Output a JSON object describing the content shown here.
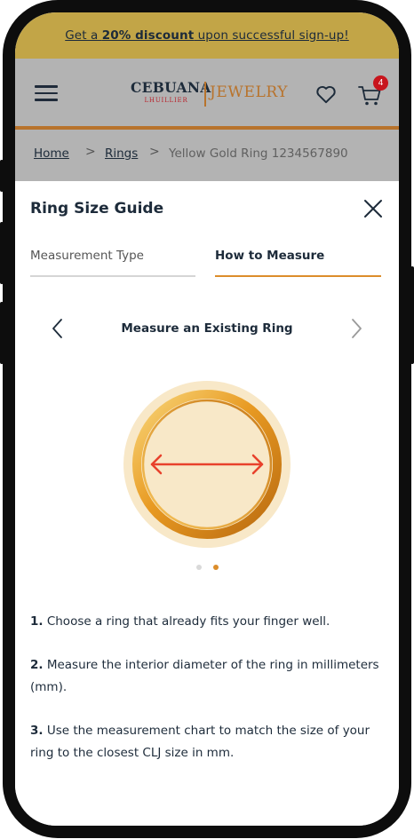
{
  "promo": {
    "prefix": "Get a ",
    "highlight": "20% discount",
    "suffix": " upon successful sign-up!"
  },
  "header": {
    "logo": {
      "brand": "CEBUANA",
      "sub": "LHUILLIER",
      "product": "JEWELRY"
    },
    "icons": [
      "menu-icon",
      "heart-icon",
      "cart-icon"
    ],
    "cart_count": "4",
    "colors": {
      "accent": "#b8732c",
      "badge": "#c8151d"
    }
  },
  "breadcrumb": {
    "items": [
      "Home",
      "Rings",
      "Yellow Gold Ring 1234567890"
    ],
    "separator": ">"
  },
  "guide": {
    "title": "Ring Size Guide",
    "tabs": [
      {
        "label": "Measurement Type",
        "active": false
      },
      {
        "label": "How to Measure",
        "active": true
      }
    ],
    "slide_title": "Measure an Existing Ring",
    "carousel": {
      "total": 2,
      "current": 2
    },
    "steps": [
      {
        "num": "1.",
        "text": " Choose a ring that already fits your finger well."
      },
      {
        "num": "2.",
        "text": "  Measure the interior diameter of the ring in millimeters (mm)."
      },
      {
        "num": "3.",
        "text": " Use the measurement chart to match the size of your ring to the closest CLJ size in mm."
      }
    ]
  }
}
